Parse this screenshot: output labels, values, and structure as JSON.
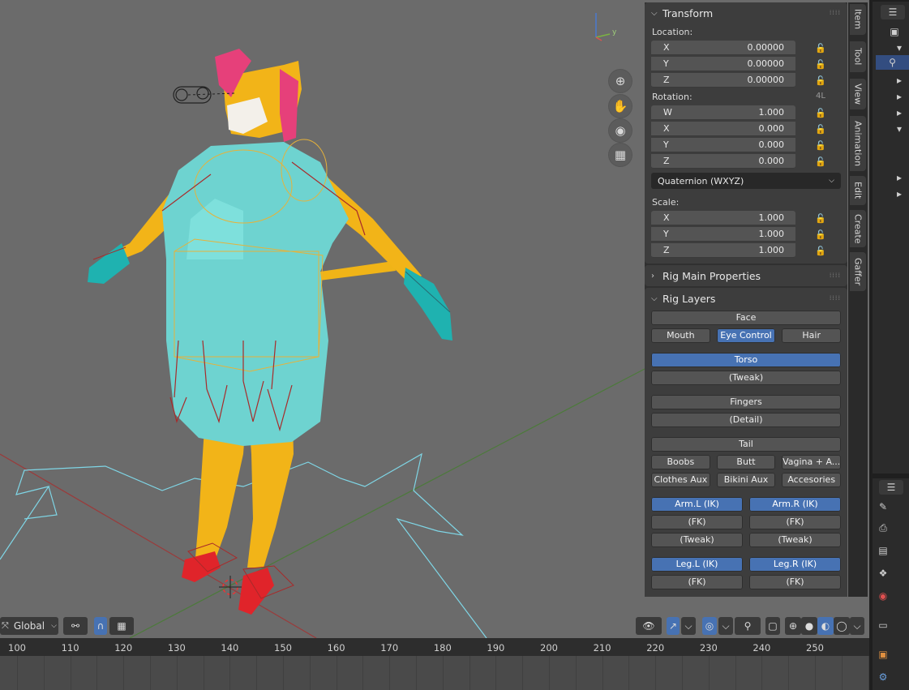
{
  "nav_icons": [
    "zoom-icon",
    "pan-hand-icon",
    "camera-view-icon",
    "ortho-grid-icon"
  ],
  "transform": {
    "title": "Transform",
    "location_label": "Location:",
    "location": [
      {
        "axis": "X",
        "value": "0.00000"
      },
      {
        "axis": "Y",
        "value": "0.00000"
      },
      {
        "axis": "Z",
        "value": "0.00000"
      }
    ],
    "rotation_label": "Rotation:",
    "rotation_badge": "4L",
    "rotation": [
      {
        "axis": "W",
        "value": "1.000"
      },
      {
        "axis": "X",
        "value": "0.000"
      },
      {
        "axis": "Y",
        "value": "0.000"
      },
      {
        "axis": "Z",
        "value": "0.000"
      }
    ],
    "rotation_mode": "Quaternion (WXYZ)",
    "scale_label": "Scale:",
    "scale": [
      {
        "axis": "X",
        "value": "1.000"
      },
      {
        "axis": "Y",
        "value": "1.000"
      },
      {
        "axis": "Z",
        "value": "1.000"
      }
    ]
  },
  "rig_main": {
    "title": "Rig Main Properties"
  },
  "rig_layers": {
    "title": "Rig Layers",
    "rows": [
      [
        {
          "label": "Face",
          "on": false
        }
      ],
      [
        {
          "label": "Mouth",
          "on": false
        },
        {
          "label": "Eye Control",
          "on": true
        },
        {
          "label": "Hair",
          "on": false
        }
      ],
      "gap",
      [
        {
          "label": "Torso",
          "on": true
        }
      ],
      [
        {
          "label": "(Tweak)",
          "on": false
        }
      ],
      "gap",
      [
        {
          "label": "Fingers",
          "on": false
        }
      ],
      [
        {
          "label": "(Detail)",
          "on": false
        }
      ],
      "gap",
      [
        {
          "label": "Tail",
          "on": false
        }
      ],
      [
        {
          "label": "Boobs",
          "on": false
        },
        {
          "label": "Butt",
          "on": false
        },
        {
          "label": "Vagina + A...",
          "on": false
        }
      ],
      [
        {
          "label": "Clothes Aux",
          "on": false
        },
        {
          "label": "Bikini Aux",
          "on": false
        },
        {
          "label": "Accesories",
          "on": false
        }
      ],
      "gap",
      [
        {
          "label": "Arm.L (IK)",
          "on": true
        },
        {
          "label": "Arm.R (IK)",
          "on": true
        }
      ],
      [
        {
          "label": "(FK)",
          "on": false
        },
        {
          "label": "(FK)",
          "on": false
        }
      ],
      [
        {
          "label": "(Tweak)",
          "on": false
        },
        {
          "label": "(Tweak)",
          "on": false
        }
      ],
      "gap",
      [
        {
          "label": "Leg.L (IK)",
          "on": true
        },
        {
          "label": "Leg.R (IK)",
          "on": true
        }
      ],
      [
        {
          "label": "(FK)",
          "on": false
        },
        {
          "label": "(FK)",
          "on": false
        }
      ]
    ]
  },
  "tabs": [
    "Item",
    "Tool",
    "View",
    "Animation",
    "Edit",
    "Create",
    "Gaffer"
  ],
  "toolbar": {
    "orientation": "Global"
  },
  "timeline": {
    "ticks": [
      "100",
      "110",
      "120",
      "130",
      "140",
      "150",
      "160",
      "170",
      "180",
      "190",
      "200",
      "210",
      "220",
      "230",
      "240",
      "250"
    ]
  },
  "colors": {
    "accent": "#4772b3",
    "viewport": "#6b6b6b",
    "panel": "#3d3d3d"
  }
}
